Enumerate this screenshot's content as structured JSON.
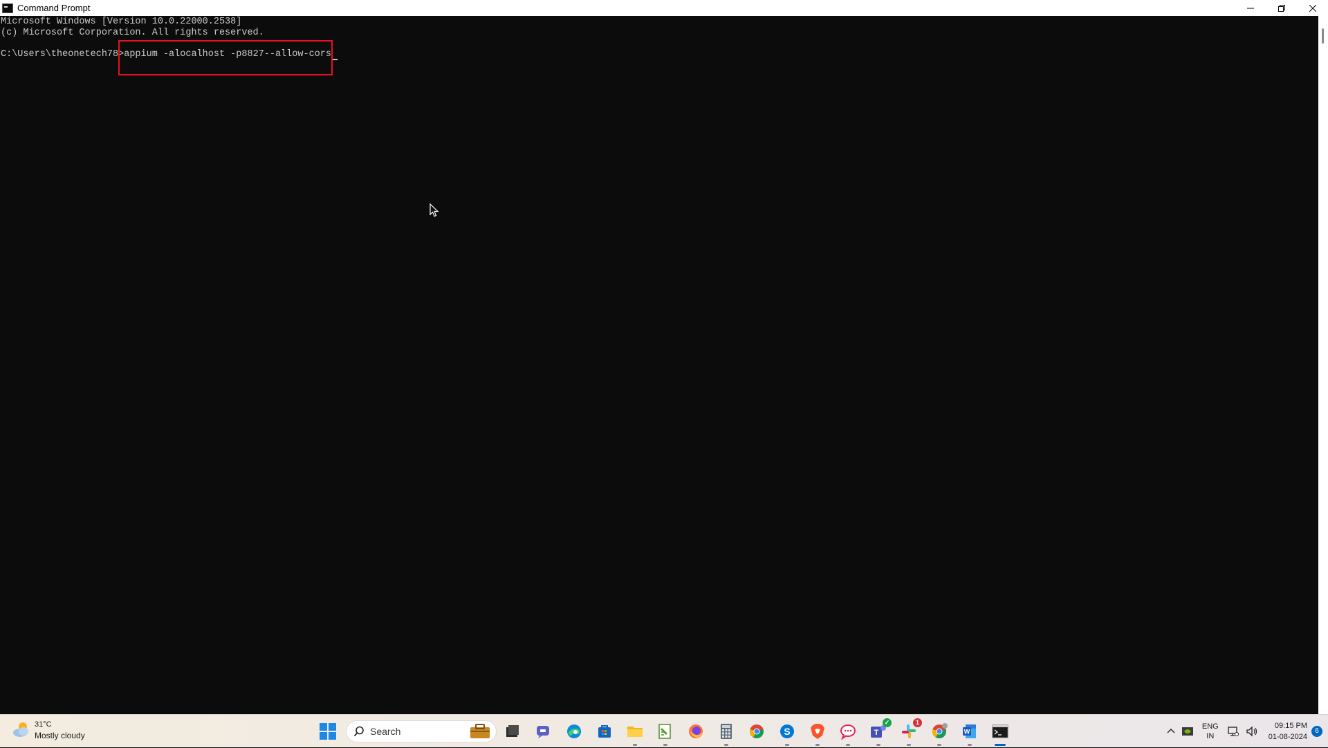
{
  "window": {
    "title": "Command Prompt"
  },
  "console": {
    "lines": [
      "Microsoft Windows [Version 10.0.22000.2538]",
      "(c) Microsoft Corporation. All rights reserved."
    ],
    "prompt": "C:\\Users\\theonetech78>",
    "command": "appium -alocalhost -p8827--allow-cors"
  },
  "taskbar": {
    "weather": {
      "temperature": "31°C",
      "condition": "Mostly cloudy"
    },
    "search_label": "Search",
    "apps": [
      {
        "name": "work-briefcase-icon"
      },
      {
        "name": "file-explorer-icon"
      },
      {
        "name": "teams-chat-icon"
      },
      {
        "name": "edge-icon"
      },
      {
        "name": "microsoft-store-icon"
      },
      {
        "name": "folder-icon"
      },
      {
        "name": "notepad-plus-icon"
      },
      {
        "name": "firefox-icon"
      },
      {
        "name": "calculator-icon"
      },
      {
        "name": "chrome-icon"
      },
      {
        "name": "skype-icon"
      },
      {
        "name": "brave-icon"
      },
      {
        "name": "messages-icon"
      },
      {
        "name": "teams-icon"
      },
      {
        "name": "slack-icon",
        "badge": "1"
      },
      {
        "name": "chrome-profile-icon"
      },
      {
        "name": "word-icon"
      },
      {
        "name": "command-prompt-icon"
      }
    ],
    "tray": {
      "language_top": "ENG",
      "language_bottom": "IN",
      "time": "09:15 PM",
      "date": "01-08-2024",
      "notification_count": "6"
    }
  },
  "colors": {
    "console_bg": "#0c0c0c",
    "console_text": "#cccccc",
    "highlight": "#e81123",
    "accent": "#0067c0"
  }
}
